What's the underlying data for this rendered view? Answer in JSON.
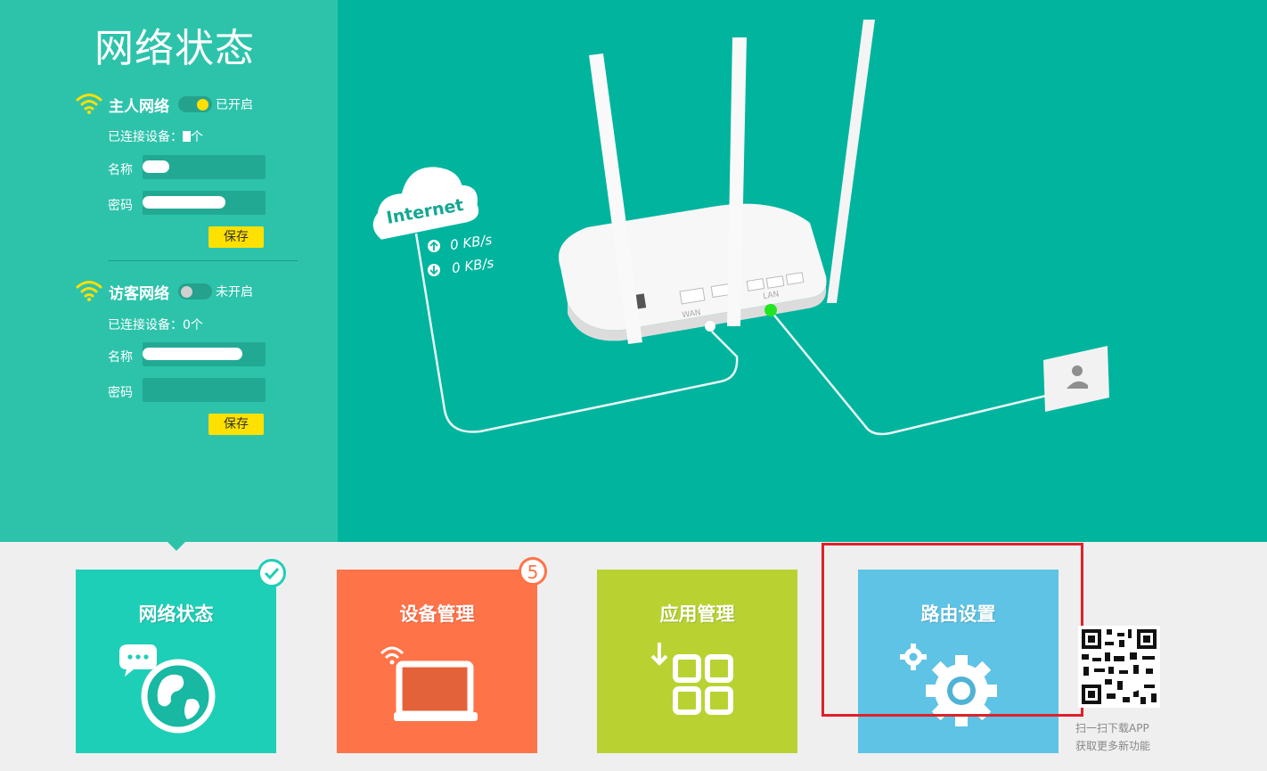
{
  "page": {
    "title": "网络状态"
  },
  "host_network": {
    "title": "主人网络",
    "toggle_state": "已开启",
    "connected_label": "已连接设备：",
    "connected_value": "个",
    "name_label": "名称",
    "password_label": "密码",
    "save_label": "保存"
  },
  "guest_network": {
    "title": "访客网络",
    "toggle_state": "未开启",
    "connected_label": "已连接设备：",
    "connected_value": "0个",
    "name_label": "名称",
    "password_label": "密码",
    "save_label": "保存"
  },
  "diagram": {
    "cloud_label": "Internet",
    "upload_speed": "0 KB/s",
    "download_speed": "0 KB/s",
    "wan_label": "WAN",
    "lan_label": "LAN"
  },
  "tiles": [
    {
      "label": "网络状态",
      "color": "#1ecfb7",
      "icon": "globe-chat-icon",
      "badge": "check"
    },
    {
      "label": "设备管理",
      "color": "#ff7349",
      "icon": "laptop-wifi-icon",
      "badge": "5"
    },
    {
      "label": "应用管理",
      "color": "#b9d232",
      "icon": "apps-grid-icon"
    },
    {
      "label": "路由设置",
      "color": "#5ec3e5",
      "icon": "gears-icon"
    }
  ],
  "qr": {
    "caption_line1": "扫一扫下载APP",
    "caption_line2": "获取更多新功能"
  },
  "colors": {
    "top_bg": "#00b49e",
    "left_panel": "#2dc3ab",
    "save_button": "#ffe100",
    "highlight_box": "#e0202a",
    "wifi_icon": "#ffe000",
    "lan_led": "#22e622"
  }
}
